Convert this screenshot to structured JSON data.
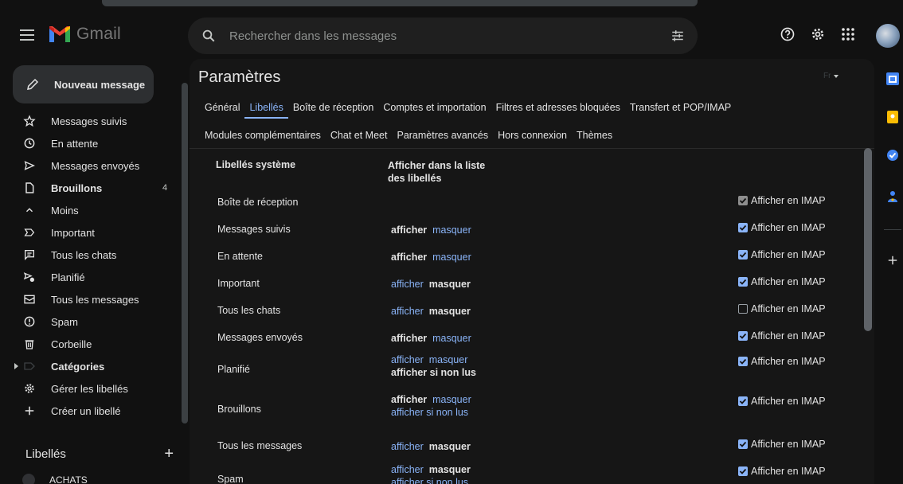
{
  "app": {
    "name": "Gmail",
    "accent": "#8ab4f8",
    "background": "#111111"
  },
  "search": {
    "placeholder": "Rechercher dans les messages"
  },
  "header_icons": [
    "help-icon",
    "gear-icon",
    "apps-grid-icon"
  ],
  "compose": {
    "label": "Nouveau message"
  },
  "sidebar": {
    "items": [
      {
        "label": "Messages suivis",
        "icon": "star-icon"
      },
      {
        "label": "En attente",
        "icon": "clock-icon"
      },
      {
        "label": "Messages envoyés",
        "icon": "send-icon"
      },
      {
        "label": "Brouillons",
        "icon": "draft-icon",
        "count": "4",
        "bold": true
      },
      {
        "label": "Moins",
        "icon": "chevron-up-icon"
      },
      {
        "label": "Important",
        "icon": "important-icon"
      },
      {
        "label": "Tous les chats",
        "icon": "chat-icon"
      },
      {
        "label": "Planifié",
        "icon": "schedule-send-icon"
      },
      {
        "label": "Tous les messages",
        "icon": "all-mail-icon"
      },
      {
        "label": "Spam",
        "icon": "spam-icon"
      },
      {
        "label": "Corbeille",
        "icon": "trash-icon"
      },
      {
        "label": "Catégories",
        "icon": "label-icon",
        "bold": true,
        "expander": true
      },
      {
        "label": "Gérer les libellés",
        "icon": "gear-icon"
      },
      {
        "label": "Créer un libellé",
        "icon": "plus-icon"
      }
    ],
    "labels_title": "Libellés",
    "labels": [
      {
        "label": "ACHATS"
      }
    ]
  },
  "settings": {
    "title": "Paramètres",
    "lang_picker": "Fr",
    "tabs_row1": [
      "Général",
      "Libellés",
      "Boîte de réception",
      "Comptes et importation",
      "Filtres et adresses bloquées",
      "Transfert et POP/IMAP"
    ],
    "tabs_row2": [
      "Modules complémentaires",
      "Chat et Meet",
      "Paramètres avancés",
      "Hors connexion",
      "Thèmes"
    ],
    "active_tab": "Libellés",
    "col_system": "Libellés système",
    "col_show": "Afficher dans la liste des libellés",
    "imap_label": "Afficher en IMAP",
    "show_word": "afficher",
    "hide_word": "masquer",
    "unread_word": "afficher si non lus",
    "rows": [
      {
        "name": "Boîte de réception",
        "mode": "none",
        "imap": "disabled"
      },
      {
        "name": "Messages suivis",
        "mode": "show",
        "imap": "on"
      },
      {
        "name": "En attente",
        "mode": "show",
        "imap": "on"
      },
      {
        "name": "Important",
        "mode": "hide",
        "imap": "on"
      },
      {
        "name": "Tous les chats",
        "mode": "hide",
        "imap": "off"
      },
      {
        "name": "Messages envoyés",
        "mode": "show",
        "imap": "on"
      },
      {
        "name": "Planifié",
        "mode": "unread",
        "imap": "on"
      },
      {
        "name": "Brouillons",
        "mode": "show3",
        "imap": "on"
      },
      {
        "name": "Tous les messages",
        "mode": "hide",
        "imap": "on"
      },
      {
        "name": "Spam",
        "mode": "hide3",
        "imap": "on"
      }
    ]
  },
  "right_rail": [
    "calendar-icon",
    "keep-icon",
    "tasks-icon",
    "contacts-icon",
    "plus-icon"
  ]
}
